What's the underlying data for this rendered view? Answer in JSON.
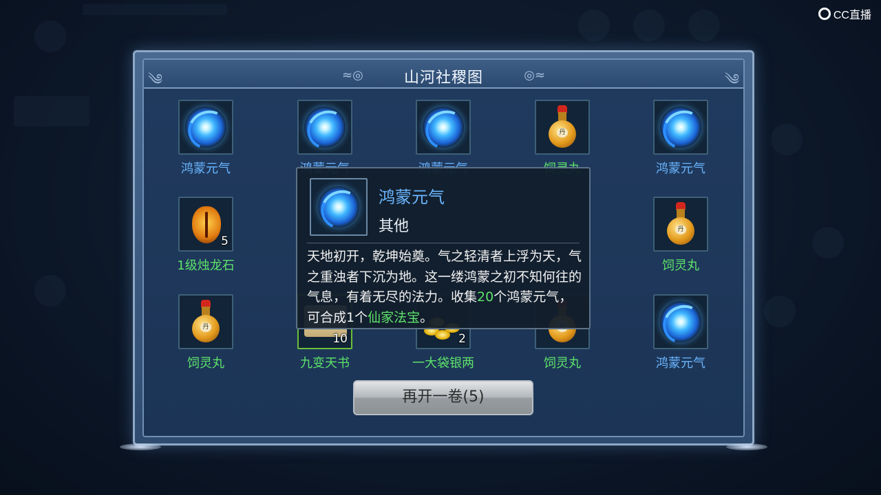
{
  "watermark": "CC直播",
  "dialog": {
    "title": "山河社稷图"
  },
  "items": [
    {
      "name": "鸿蒙元气",
      "icon": "hongmeng-swirl-icon",
      "color": "blue"
    },
    {
      "name": "鸿蒙元气",
      "icon": "hongmeng-swirl-icon",
      "color": "blue"
    },
    {
      "name": "鸿蒙元气",
      "icon": "hongmeng-swirl-icon",
      "color": "blue"
    },
    {
      "name": "饲灵丸",
      "icon": "elixir-gourd-icon",
      "color": "green"
    },
    {
      "name": "鸿蒙元气",
      "icon": "hongmeng-swirl-icon",
      "color": "blue"
    },
    {
      "name": "1级烛龙石",
      "icon": "zhulong-stone-icon",
      "color": "green",
      "count": "5"
    },
    {
      "name": "饲灵丸",
      "icon": "elixir-gourd-icon",
      "color": "green"
    },
    {
      "name": "饲灵丸",
      "icon": "elixir-gourd-icon",
      "color": "green"
    },
    {
      "name": "九变天书",
      "icon": "scroll-book-icon",
      "color": "green",
      "count": "10"
    },
    {
      "name": "一大袋银两",
      "icon": "silver-coins-icon",
      "color": "green",
      "count": "2"
    },
    {
      "name": "饲灵丸",
      "icon": "elixir-gourd-icon",
      "color": "green"
    },
    {
      "name": "鸿蒙元气",
      "icon": "hongmeng-swirl-icon",
      "color": "blue"
    }
  ],
  "tooltip": {
    "name": "鸿蒙元气",
    "type": "其他",
    "desc_1": "天地初开，乾坤始奠。气之轻清者上浮为天，气之重浊者下沉为地。这一缕鸿蒙之初不知何往的气息，有着无尽的法力。收集",
    "desc_count": "20",
    "desc_2": "个鸿蒙元气，可合成1个",
    "desc_item": "仙家法宝",
    "desc_end": "。"
  },
  "button": {
    "label": "再开一卷(5)"
  },
  "colors": {
    "blue_text": "#6bb6ff",
    "green_text": "#5ee36a",
    "button": "#b4b8bc"
  }
}
